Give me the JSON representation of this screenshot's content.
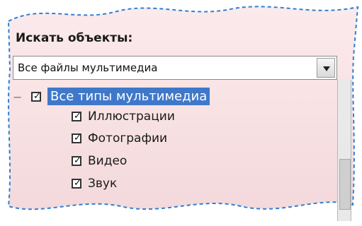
{
  "search": {
    "label": "Искать объекты:",
    "selected_value": "Все файлы мультимедиа"
  },
  "tree": {
    "root": {
      "label": "Все типы мультимедиа",
      "checked": true,
      "expanded": true
    },
    "items": [
      {
        "label": "Иллюстрации",
        "checked": true
      },
      {
        "label": "Фотографии",
        "checked": true
      },
      {
        "label": "Видео",
        "checked": true
      },
      {
        "label": "Звук",
        "checked": true
      }
    ]
  },
  "colors": {
    "selection": "#3f78c9",
    "background_tint": "#f7e1e3",
    "dashed_border": "#2f7fd3"
  },
  "icons": {
    "dropdown": "chevron-down-icon",
    "expander": "collapse-icon",
    "checkbox": "checkmark-icon"
  }
}
